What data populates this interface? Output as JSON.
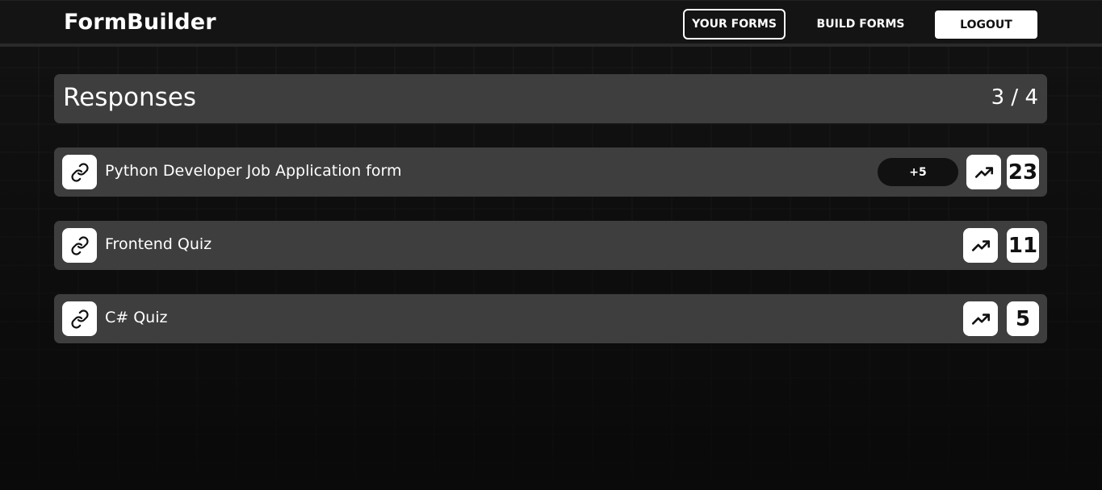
{
  "navbar": {
    "brand": "FormBuilder",
    "your_forms": "YOUR FORMS",
    "build_forms": "BUILD FORMS",
    "logout": "LOGOUT"
  },
  "responses": {
    "title": "Responses",
    "count": "3 / 4"
  },
  "forms": [
    {
      "title": "Python Developer Job Application form",
      "badge": "+5",
      "responses": "23",
      "link_icon": "link-icon",
      "trend_icon": "trending-up-icon"
    },
    {
      "title": "Frontend Quiz",
      "responses": "11",
      "link_icon": "link-icon",
      "trend_icon": "trending-up-icon"
    },
    {
      "title": "C# Quiz",
      "responses": "5",
      "link_icon": "link-icon",
      "trend_icon": "trending-up-icon"
    }
  ],
  "colors": {
    "background": "#121212",
    "card": "#3e3e3e",
    "accent": "#ffffff",
    "badge_bg": "#111111"
  }
}
